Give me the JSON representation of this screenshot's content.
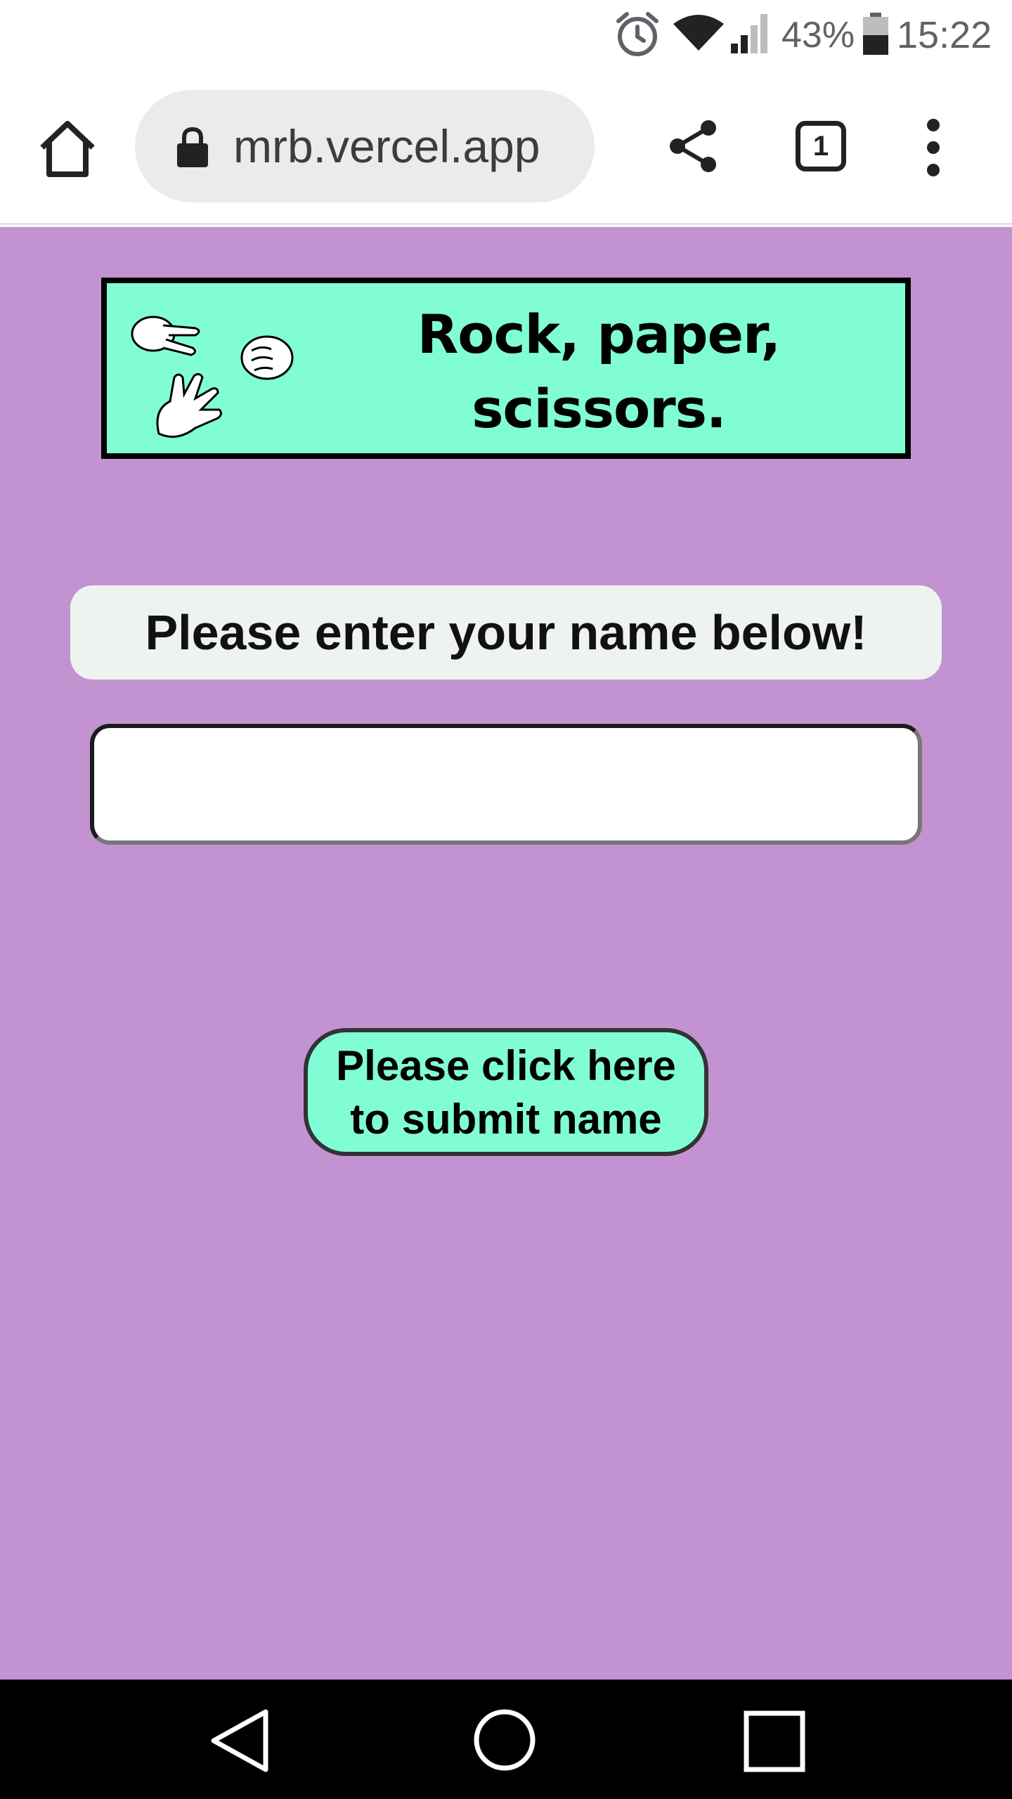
{
  "status_bar": {
    "battery_percent": "43%",
    "time": "15:22",
    "icons": [
      "alarm-icon",
      "wifi-icon",
      "signal-icon",
      "battery-icon"
    ]
  },
  "browser": {
    "url": "mrb.vercel.app",
    "tab_count": "1",
    "icons": [
      "home-icon",
      "lock-icon",
      "share-icon",
      "tabs-icon",
      "more-vert-icon"
    ]
  },
  "page": {
    "banner_title_line1": "Rock, paper,",
    "banner_title_line2": "scissors.",
    "prompt": "Please enter your name below!",
    "name_input_value": "",
    "submit_line1": "Please click here",
    "submit_line2": "to submit name"
  },
  "nav_bar": {
    "icons": [
      "back-icon",
      "home-circle-icon",
      "recents-icon"
    ]
  },
  "colors": {
    "page_background": "#c393d1",
    "accent_mint": "#80fdd5",
    "prompt_background": "#eef3ef"
  }
}
